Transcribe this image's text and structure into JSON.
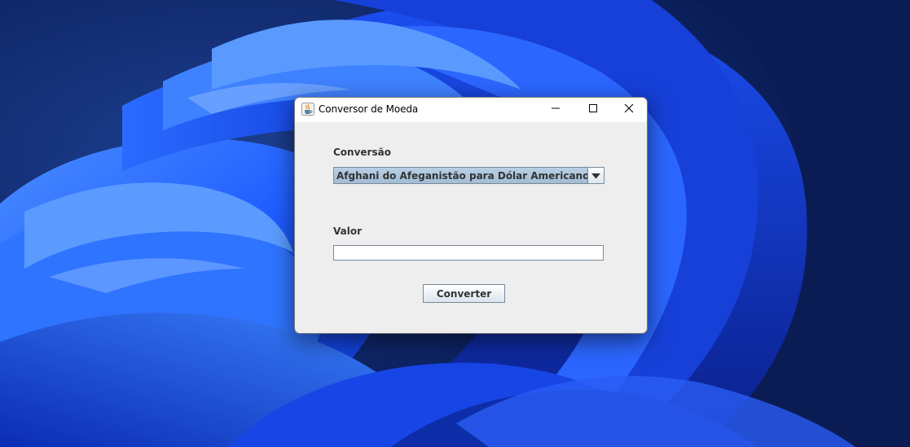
{
  "window": {
    "title": "Conversor de Moeda",
    "icon": "java-coffee-cup-icon"
  },
  "titlebar_buttons": {
    "minimize_icon": "minimize-icon",
    "maximize_icon": "maximize-icon",
    "close_icon": "close-icon"
  },
  "form": {
    "conversion_label": "Conversão",
    "conversion_selected": "Afghani do Afeganistão para Dólar Americano",
    "value_label": "Valor",
    "value_input": "",
    "convert_button_label": "Converter"
  },
  "colors": {
    "window_background": "#eeeeee",
    "select_background": "#a3bdd6",
    "wallpaper_primary": "#1e5bff",
    "wallpaper_dark": "#0a1a4a"
  }
}
